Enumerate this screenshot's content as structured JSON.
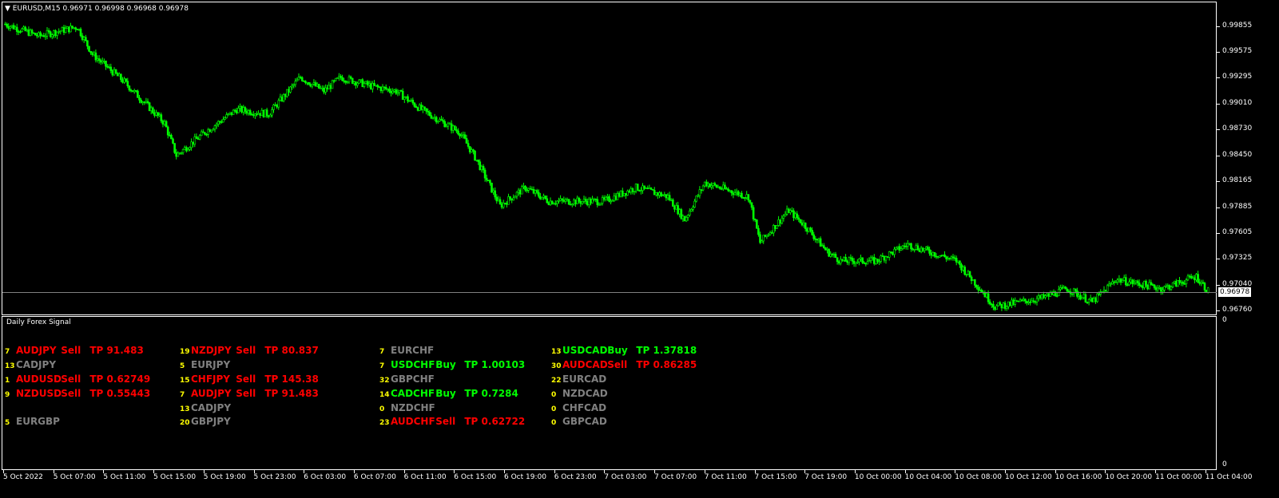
{
  "header": {
    "title": "EURUSD,M15  0.96971 0.96998 0.96968 0.96978",
    "current_price": "0.96978"
  },
  "indicator": {
    "title": "Daily Forex Signal",
    "scale_top": "0",
    "scale_bottom": "0"
  },
  "colors": {
    "bull": "#00ff00",
    "bear": "#ffffff",
    "sell": "#ff0000",
    "buy": "#00ff00",
    "neutral": "#808080",
    "count": "#ffff00"
  },
  "price_axis": [
    "0.99855",
    "0.99575",
    "0.99295",
    "0.99010",
    "0.98730",
    "0.98450",
    "0.98165",
    "0.97885",
    "0.97605",
    "0.97325",
    "0.97040",
    "0.96760"
  ],
  "time_axis": [
    "5 Oct 2022",
    "5 Oct 07:00",
    "5 Oct 11:00",
    "5 Oct 15:00",
    "5 Oct 19:00",
    "5 Oct 23:00",
    "6 Oct 03:00",
    "6 Oct 07:00",
    "6 Oct 11:00",
    "6 Oct 15:00",
    "6 Oct 19:00",
    "6 Oct 23:00",
    "7 Oct 03:00",
    "7 Oct 07:00",
    "7 Oct 11:00",
    "7 Oct 15:00",
    "7 Oct 19:00",
    "10 Oct 00:00",
    "10 Oct 04:00",
    "10 Oct 08:00",
    "10 Oct 12:00",
    "10 Oct 16:00",
    "10 Oct 20:00",
    "11 Oct 00:00",
    "11 Oct 04:00"
  ],
  "chart_data": {
    "type": "candlestick",
    "symbol": "EURUSD",
    "timeframe": "M15",
    "ylim": [
      0.9666,
      0.9999
    ],
    "close_path": [
      [
        0,
        0.9988
      ],
      [
        20,
        0.9975
      ],
      [
        43,
        0.9985
      ],
      [
        52,
        0.9955
      ],
      [
        71,
        0.9925
      ],
      [
        95,
        0.988
      ],
      [
        102,
        0.9845
      ],
      [
        119,
        0.987
      ],
      [
        138,
        0.9895
      ],
      [
        157,
        0.989
      ],
      [
        176,
        0.993
      ],
      [
        190,
        0.9915
      ],
      [
        200,
        0.993
      ],
      [
        219,
        0.992
      ],
      [
        233,
        0.9915
      ],
      [
        248,
        0.9895
      ],
      [
        271,
        0.987
      ],
      [
        281,
        0.984
      ],
      [
        295,
        0.979
      ],
      [
        310,
        0.981
      ],
      [
        324,
        0.9795
      ],
      [
        357,
        0.9795
      ],
      [
        376,
        0.981
      ],
      [
        395,
        0.98
      ],
      [
        405,
        0.9775
      ],
      [
        417,
        0.9815
      ],
      [
        443,
        0.98
      ],
      [
        450,
        0.975
      ],
      [
        467,
        0.9785
      ],
      [
        476,
        0.977
      ],
      [
        490,
        0.974
      ],
      [
        498,
        0.973
      ],
      [
        519,
        0.973
      ],
      [
        538,
        0.9748
      ],
      [
        567,
        0.973
      ],
      [
        581,
        0.97
      ],
      [
        590,
        0.968
      ],
      [
        619,
        0.969
      ],
      [
        633,
        0.97
      ],
      [
        648,
        0.9685
      ],
      [
        662,
        0.971
      ],
      [
        690,
        0.97
      ],
      [
        710,
        0.9713
      ],
      [
        717,
        0.9697
      ]
    ]
  },
  "signals": [
    [
      {
        "count": "7",
        "symbol": "AUDJPY",
        "action": "Sell",
        "tp": "TP 91.483",
        "type": "sell"
      },
      {
        "count": "13",
        "symbol": "CADJPY",
        "type": "neutral"
      },
      {
        "count": "1",
        "symbol": "AUDUSD",
        "action": "Sell",
        "tp": "TP 0.62749",
        "type": "sell"
      },
      {
        "count": "9",
        "symbol": "NZDUSD",
        "action": "Sell",
        "tp": "TP 0.55443",
        "type": "sell"
      },
      null,
      {
        "count": "5",
        "symbol": "EURGBP",
        "type": "neutral"
      }
    ],
    [
      {
        "count": "19",
        "symbol": "NZDJPY",
        "action": "Sell",
        "tp": "TP 80.837",
        "type": "sell"
      },
      {
        "count": "5",
        "symbol": "EURJPY",
        "type": "neutral"
      },
      {
        "count": "15",
        "symbol": "CHFJPY",
        "action": "Sell",
        "tp": "TP 145.38",
        "type": "sell"
      },
      {
        "count": "7",
        "symbol": "AUDJPY",
        "action": "Sell",
        "tp": "TP 91.483",
        "type": "sell"
      },
      {
        "count": "13",
        "symbol": "CADJPY",
        "type": "neutral"
      },
      {
        "count": "20",
        "symbol": "GBPJPY",
        "type": "neutral"
      }
    ],
    [
      {
        "count": "7",
        "symbol": "EURCHF",
        "type": "neutral"
      },
      {
        "count": "7",
        "symbol": "USDCHF",
        "action": "Buy",
        "tp": "TP 1.00103",
        "type": "buy"
      },
      {
        "count": "32",
        "symbol": "GBPCHF",
        "type": "neutral"
      },
      {
        "count": "14",
        "symbol": "CADCHF",
        "action": "Buy",
        "tp": "TP 0.7284",
        "type": "buy"
      },
      {
        "count": "0",
        "symbol": "NZDCHF",
        "type": "neutral"
      },
      {
        "count": "23",
        "symbol": "AUDCHF",
        "action": "Sell",
        "tp": "TP 0.62722",
        "type": "sell"
      }
    ],
    [
      {
        "count": "13",
        "symbol": "USDCAD",
        "action": "Buy",
        "tp": "TP 1.37818",
        "type": "buy"
      },
      {
        "count": "30",
        "symbol": "AUDCAD",
        "action": "Sell",
        "tp": "TP 0.86285",
        "type": "sell"
      },
      {
        "count": "22",
        "symbol": "EURCAD",
        "type": "neutral"
      },
      {
        "count": "0",
        "symbol": "NZDCAD",
        "type": "neutral"
      },
      {
        "count": "0",
        "symbol": "CHFCAD",
        "type": "neutral"
      },
      {
        "count": "0",
        "symbol": "GBPCAD",
        "type": "neutral"
      }
    ]
  ]
}
